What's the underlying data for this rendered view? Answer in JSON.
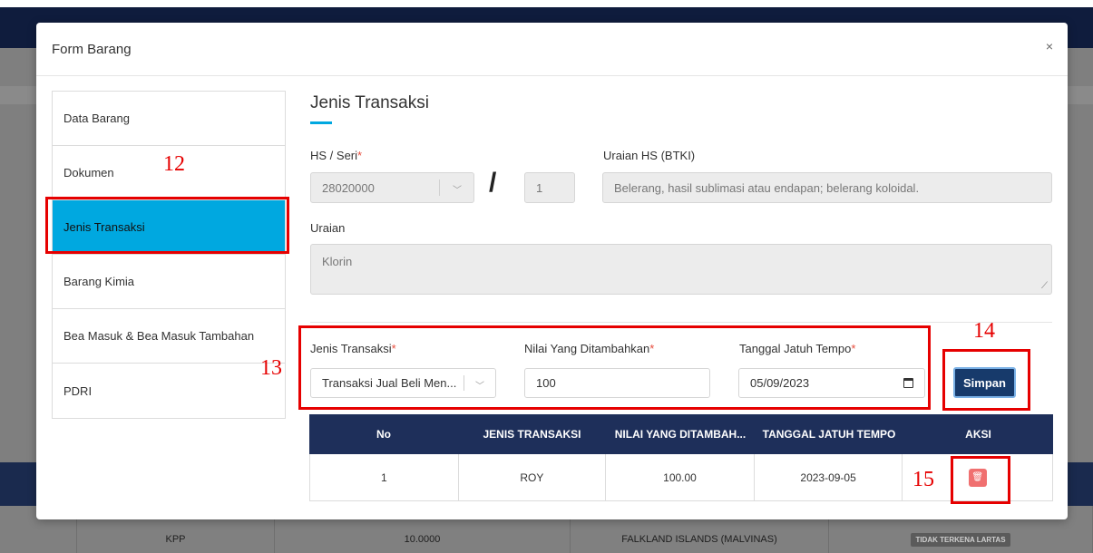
{
  "background": {
    "row_cells": [
      "KPP",
      "10.0000",
      "FALKLAND ISLANDS (MALVINAS)"
    ],
    "badge": "TIDAK TERKENA LARTAS"
  },
  "modal": {
    "title": "Form Barang",
    "close_icon": "×"
  },
  "nav": {
    "items": [
      {
        "label": "Data Barang"
      },
      {
        "label": "Dokumen"
      },
      {
        "label": "Jenis Transaksi",
        "active": true
      },
      {
        "label": "Barang Kimia"
      },
      {
        "label": "Bea Masuk & Bea Masuk Tambahan"
      },
      {
        "label": "PDRI"
      }
    ]
  },
  "annotations": {
    "a12": "12",
    "a13": "13",
    "a14": "14",
    "a15": "15"
  },
  "section": {
    "title": "Jenis Transaksi"
  },
  "form": {
    "hs_label": "HS / Seri",
    "hs_value": "28020000",
    "slash": "/",
    "seri_value": "1",
    "uraian_hs_label": "Uraian HS (BTKI)",
    "uraian_hs_value": "Belerang, hasil sublimasi atau endapan; belerang koloidal.",
    "uraian_label": "Uraian",
    "uraian_value": "Klorin",
    "jenis_label": "Jenis Transaksi",
    "jenis_value": "Transaksi Jual Beli Men...",
    "nilai_label": "Nilai Yang Ditambahkan",
    "nilai_value": "100",
    "tanggal_label": "Tanggal Jatuh Tempo",
    "tanggal_value": "05/09/2023",
    "required_mark": "*",
    "save_label": "Simpan"
  },
  "table": {
    "headers": [
      "No",
      "JENIS TRANSAKSI",
      "NILAI YANG DITAMBAH...",
      "TANGGAL JATUH TEMPO",
      "AKSI"
    ],
    "rows": [
      {
        "no": "1",
        "jenis": "ROY",
        "nilai": "100.00",
        "tanggal": "2023-09-05"
      }
    ]
  },
  "colors": {
    "accent": "#00a8e0",
    "primary": "#173a6b",
    "table_header": "#1e2f5a",
    "annotation": "#e60000",
    "delete": "#f07070"
  },
  "icons": [
    "close-icon",
    "chevron-down-icon",
    "calendar-icon",
    "trash-icon",
    "resize-handle-icon"
  ]
}
